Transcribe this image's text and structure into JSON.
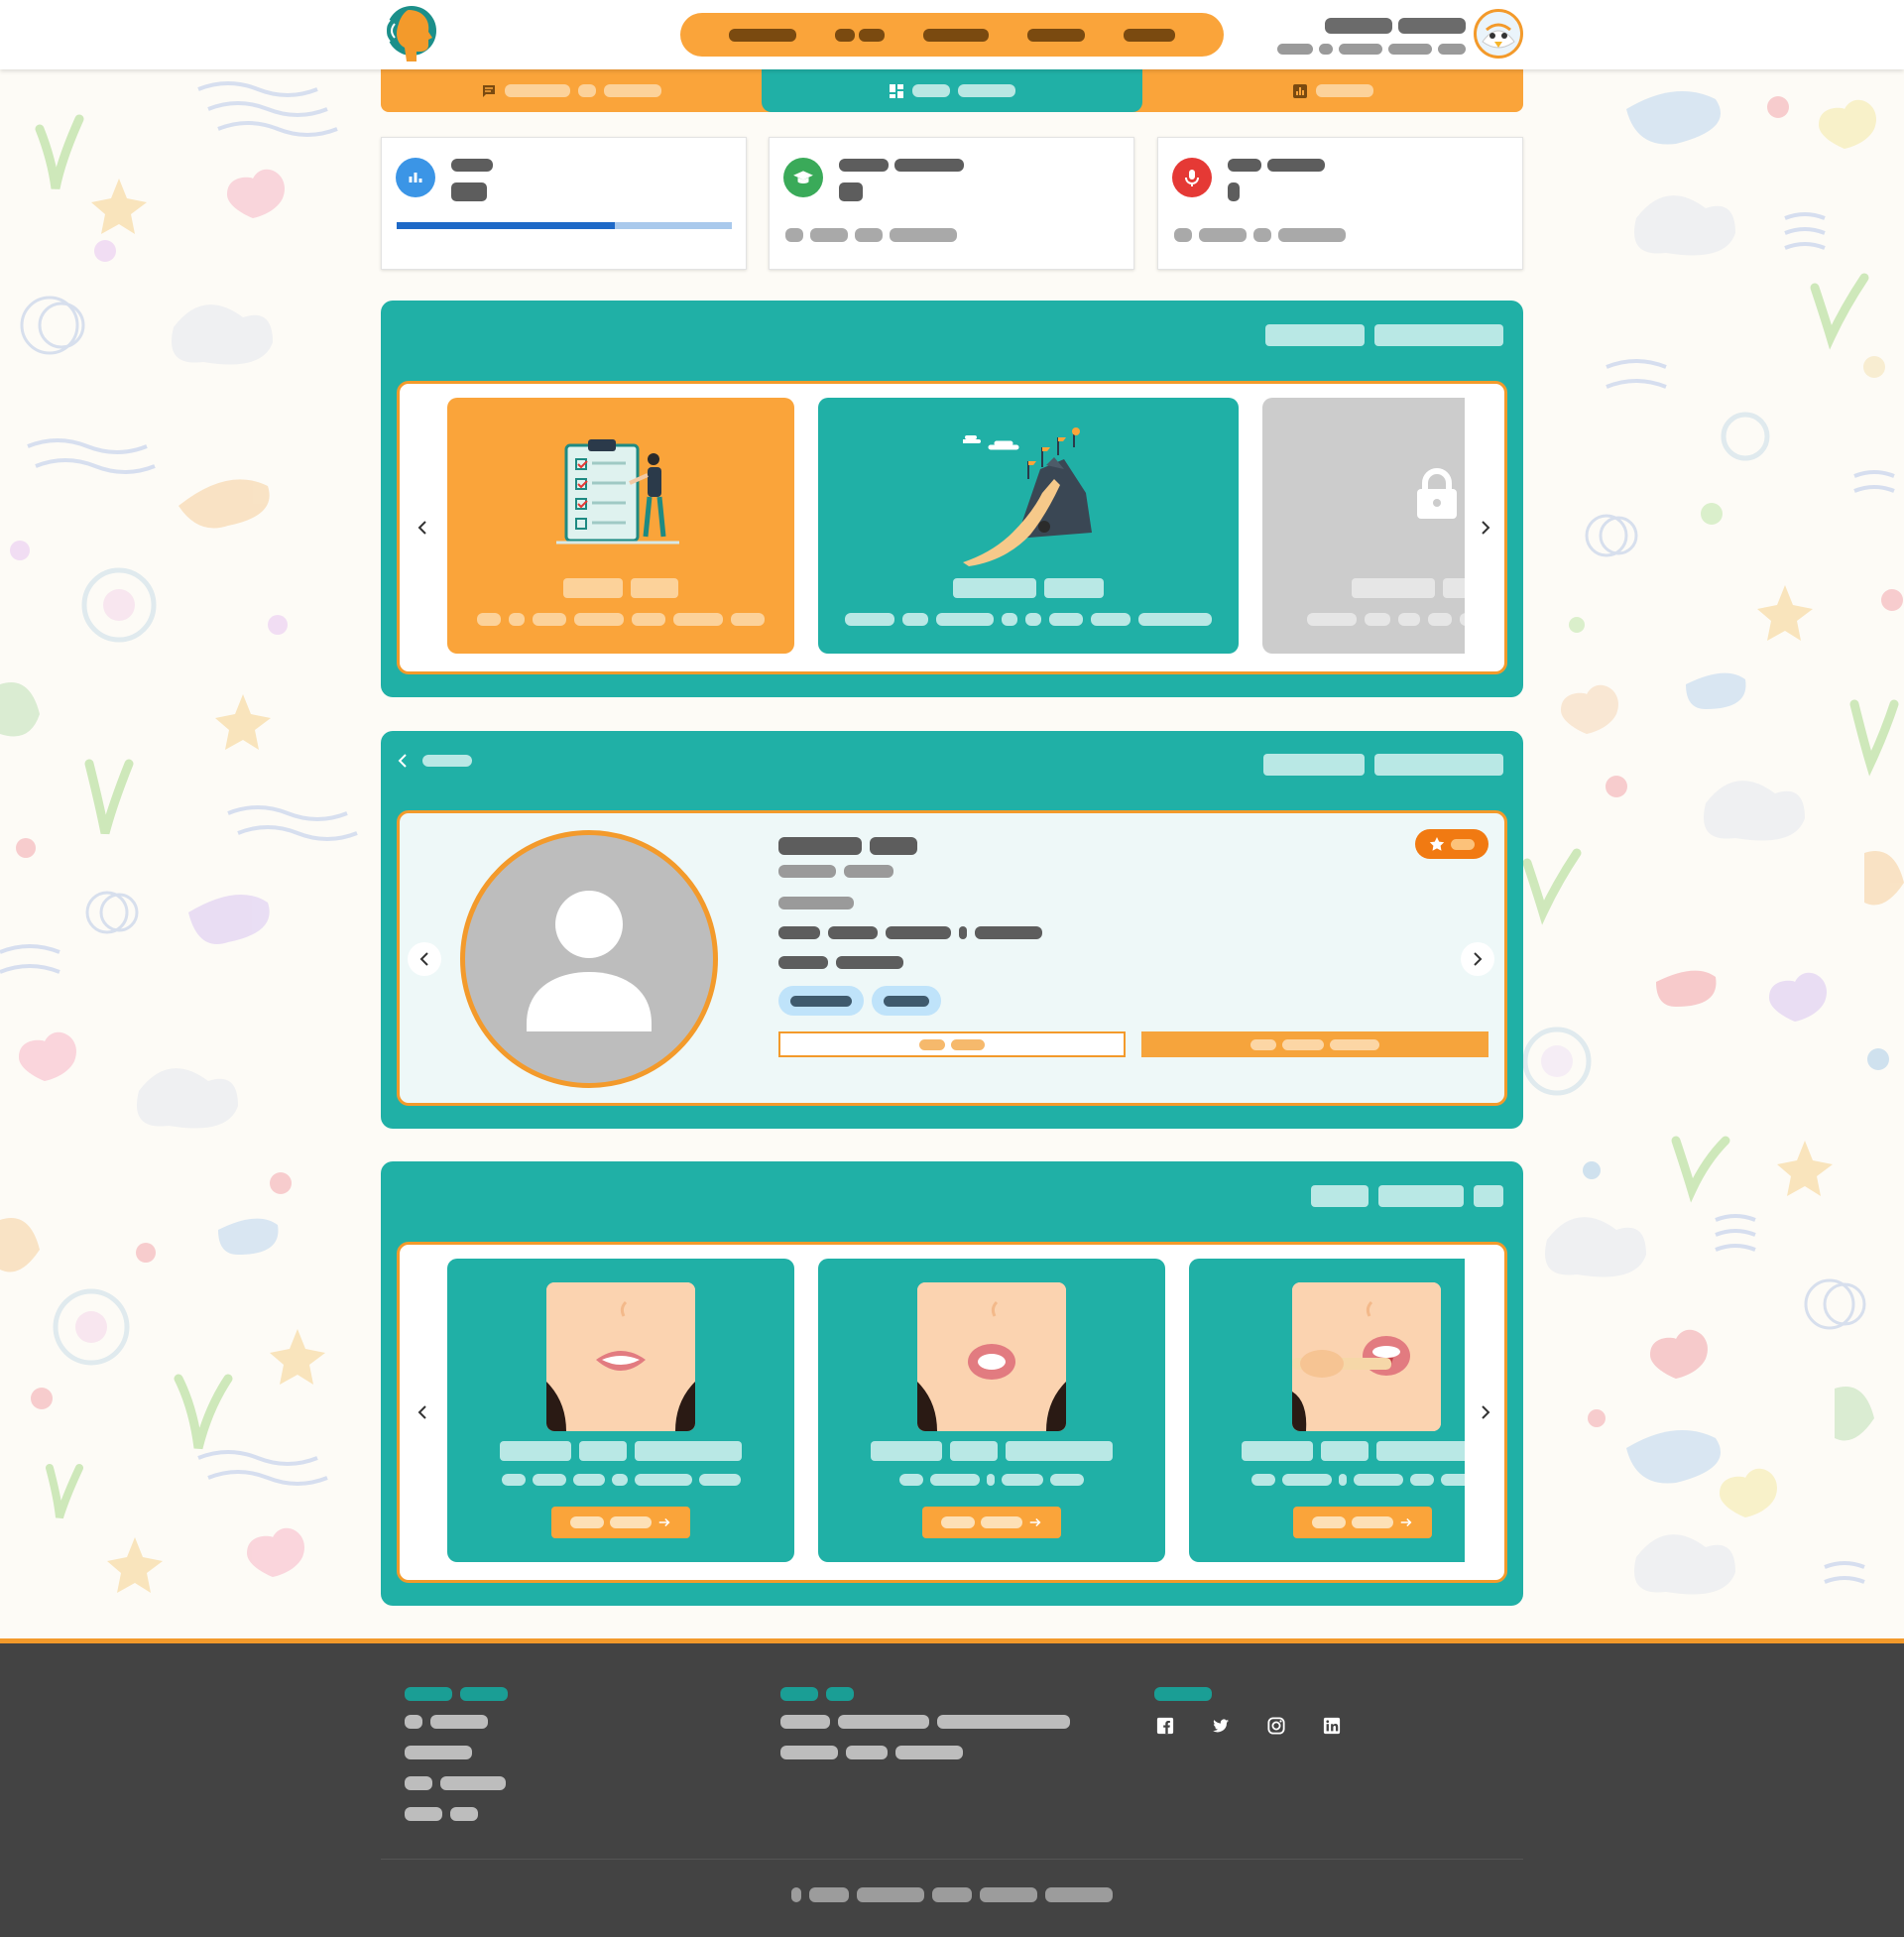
{
  "theme": {
    "teal": "#20b0a6",
    "orange": "#faa43a",
    "deep_orange": "#f17a12",
    "footer_bg": "#434343",
    "progress_fill": "#1e69c7",
    "progress_track": "#a9c9ec",
    "locked_gray": "#cccccc"
  },
  "header": {
    "logo_icon": "speaking-head-logo",
    "nav_items": [
      {
        "widths": [
          68
        ]
      },
      {
        "widths": [
          20,
          26
        ]
      },
      {
        "widths": [
          66
        ]
      },
      {
        "widths": [
          58
        ]
      },
      {
        "widths": [
          52
        ]
      }
    ],
    "user_avatar_icon": "eagle-mascot-avatar"
  },
  "tabs": [
    {
      "icon": "chat-icon",
      "active": false
    },
    {
      "icon": "dashboard-icon",
      "active": true
    },
    {
      "icon": "chart-icon",
      "active": false
    }
  ],
  "stats": [
    {
      "icon": "bar-chart-icon",
      "icon_color": "#3b95e6",
      "progress": 0.65
    },
    {
      "icon": "graduation-cap-icon",
      "icon_color": "#3aaa59"
    },
    {
      "icon": "microphone-icon",
      "icon_color": "#e53935"
    }
  ],
  "levels": [
    {
      "state": "current",
      "color": "#faa43a",
      "illustration": "clipboard-checklist-illustration"
    },
    {
      "state": "unlocked",
      "color": "#20b0a6",
      "illustration": "mountain-path-flags-illustration"
    },
    {
      "state": "locked",
      "color": "#cccccc",
      "illustration": "lock-icon"
    }
  ],
  "profile": {
    "photo_icon": "user-placeholder-icon",
    "rating_icon": "star-icon"
  },
  "exercises": [
    {
      "illustration": "smile-teeth-illustration"
    },
    {
      "illustration": "open-lips-illustration"
    },
    {
      "illustration": "tongue-depressor-illustration"
    }
  ],
  "footer": {
    "social_icons": [
      "facebook-icon",
      "twitter-icon",
      "instagram-icon",
      "linkedin-icon"
    ]
  }
}
